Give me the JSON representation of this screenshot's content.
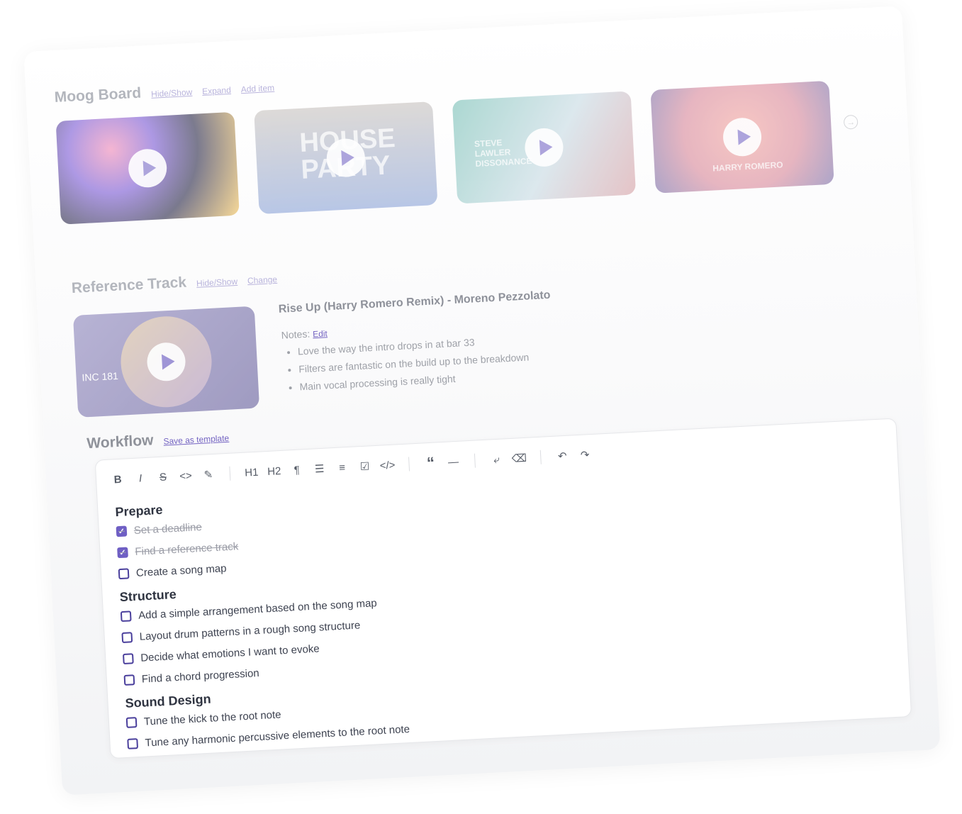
{
  "moodboard": {
    "title": "Moog Board",
    "links": [
      "Hide/Show",
      "Expand",
      "Add item"
    ],
    "cards": [
      {
        "name": "abstract-face-art",
        "text": ""
      },
      {
        "name": "house-party",
        "text": "HOUSE PARTY"
      },
      {
        "name": "steve-lawler",
        "text": "STEVE LAWLER DISSONANCE"
      },
      {
        "name": "harry-romero",
        "text": "HARRY ROMERO"
      }
    ]
  },
  "reference": {
    "title": "Reference Track",
    "links": [
      "Hide/Show",
      "Change"
    ],
    "track_title": "Rise Up (Harry Romero Remix) - Moreno Pezzolato",
    "notes_label": "Notes:",
    "edit_label": "Edit",
    "art_label": "INC 181",
    "notes": [
      "Love the way the intro drops in at bar 33",
      "Filters are fantastic on the build up to the breakdown",
      "Main vocal processing is really tight"
    ]
  },
  "workflow": {
    "title": "Workflow",
    "save_template": "Save as template",
    "toolbar": [
      "B",
      "I",
      "S",
      "<>",
      "✎",
      "H1",
      "H2",
      "¶",
      "☰",
      "≡",
      "☑",
      "</>",
      "“",
      "—",
      "⤶",
      "⌫",
      "↶",
      "↷"
    ],
    "sections": [
      {
        "heading": "Prepare",
        "tasks": [
          {
            "label": "Set a deadline",
            "checked": true
          },
          {
            "label": "Find a reference track",
            "checked": true
          },
          {
            "label": "Create a song map",
            "checked": false
          }
        ]
      },
      {
        "heading": "Structure",
        "tasks": [
          {
            "label": "Add a simple arrangement based on the song map",
            "checked": false
          },
          {
            "label": "Layout drum patterns in a rough song structure",
            "checked": false
          },
          {
            "label": "Decide what emotions I want to evoke",
            "checked": false
          },
          {
            "label": "Find a chord progression",
            "checked": false
          }
        ]
      },
      {
        "heading": "Sound Design",
        "tasks": [
          {
            "label": "Tune the kick to the root note",
            "checked": false
          },
          {
            "label": "Tune any harmonic percussive elements to the root note",
            "checked": false
          }
        ]
      }
    ]
  }
}
